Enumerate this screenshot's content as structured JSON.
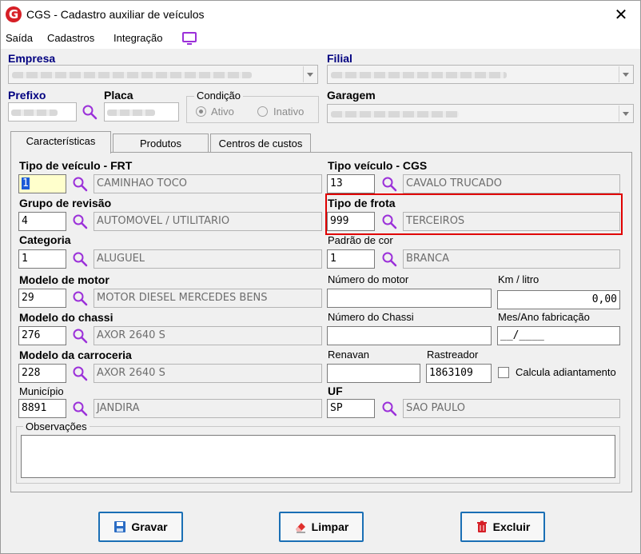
{
  "window": {
    "title": "CGS - Cadastro auxiliar de veículos",
    "close_glyph": "✕",
    "logo_glyph": "G"
  },
  "menu": {
    "items": [
      "Saída",
      "Cadastros",
      "Integração"
    ],
    "icon": "monitor-icon"
  },
  "header": {
    "empresa_label": "Empresa",
    "filial_label": "Filial",
    "prefixo_label": "Prefixo",
    "placa_label": "Placa",
    "condicao_label": "Condição",
    "condicao_options": [
      "Ativo",
      "Inativo"
    ],
    "condicao_selected": "Ativo",
    "garagem_label": "Garagem"
  },
  "tabs": [
    "Características",
    "Produtos",
    "Centros de custos"
  ],
  "active_tab": "Características",
  "fields": {
    "tipo_veiculo_frt": {
      "label": "Tipo de veículo - FRT",
      "code": "1",
      "desc": "CAMINHAO TOCO"
    },
    "tipo_veiculo_cgs": {
      "label": "Tipo veículo - CGS",
      "code": "13",
      "desc": "CAVALO TRUCADO"
    },
    "grupo_revisao": {
      "label": "Grupo de revisão",
      "code": "4",
      "desc": "AUTOMOVEL / UTILITARIO"
    },
    "tipo_frota": {
      "label": "Tipo de frota",
      "code": "999",
      "desc": "TERCEIROS"
    },
    "categoria": {
      "label": "Categoria",
      "code": "1",
      "desc": "ALUGUEL"
    },
    "padrao_cor": {
      "label": "Padrão de cor",
      "code": "1",
      "desc": "BRANCA"
    },
    "modelo_motor": {
      "label": "Modelo de motor",
      "code": "29",
      "desc": "MOTOR DIESEL MERCEDES BENS"
    },
    "numero_motor": {
      "label": "Número do motor",
      "value": ""
    },
    "km_litro": {
      "label": "Km / litro",
      "value": "0,00"
    },
    "modelo_chassi": {
      "label": "Modelo do chassi",
      "code": "276",
      "desc": "AXOR 2640 S"
    },
    "numero_chassi": {
      "label": "Número do Chassi",
      "value": ""
    },
    "mes_ano_fabricacao": {
      "label": "Mes/Ano fabricação",
      "value": "__/____"
    },
    "modelo_carroceria": {
      "label": "Modelo da carroceria",
      "code": "228",
      "desc": "AXOR 2640 S"
    },
    "renavan": {
      "label": "Renavan",
      "value": ""
    },
    "rastreador": {
      "label": "Rastreador",
      "value": "1863109"
    },
    "calcula_adiantamento": {
      "label": "Calcula adiantamento",
      "checked": false
    },
    "municipio": {
      "label": "Município",
      "code": "8891",
      "desc": "JANDIRA"
    },
    "uf": {
      "label": "UF",
      "code": "SP",
      "desc": "SAO PAULO"
    },
    "observacoes": {
      "label": "Observações",
      "value": ""
    }
  },
  "buttons": {
    "gravar": "Gravar",
    "limpar": "Limpar",
    "excluir": "Excluir"
  },
  "colors": {
    "accent_purple": "#9b30d9",
    "highlight_red": "#e00000",
    "label_blue": "#000080",
    "button_border": "#1a6fb5"
  }
}
